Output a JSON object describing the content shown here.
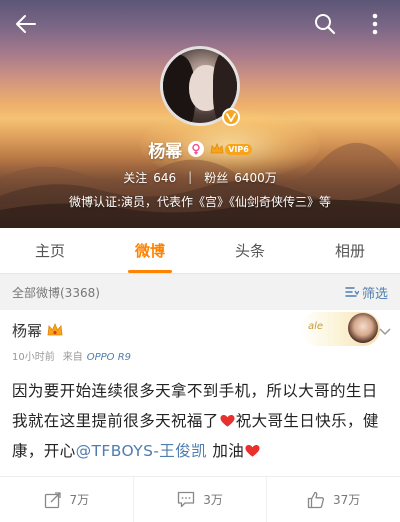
{
  "profile": {
    "name": "杨幂",
    "vip_label": "VIP6",
    "follow_label": "关注",
    "follow_count": "646",
    "fans_label": "粉丝",
    "fans_count": "6400万",
    "verification": "微博认证:演员，代表作《宫》《仙剑奇侠传三》等"
  },
  "tabs": [
    {
      "label": "主页",
      "active": false
    },
    {
      "label": "微博",
      "active": true
    },
    {
      "label": "头条",
      "active": false
    },
    {
      "label": "相册",
      "active": false
    }
  ],
  "filter_bar": {
    "count_text": "全部微博(3368)",
    "filter_label": "筛选"
  },
  "post": {
    "author": "杨幂",
    "time": "10小时前",
    "via": "来自",
    "device": "OPPO R9",
    "deco_text": "ale",
    "text_1": "因为要开始连续很多天拿不到手机，所以大哥的生日我就在这里提前很多天祝福了",
    "text_2": "祝大哥生日快乐，健康，开心",
    "mention": "@TFBOYS-王俊凯",
    "text_3": " 加油",
    "repost_count": "7万",
    "comment_count": "3万",
    "like_count": "37万"
  },
  "colors": {
    "accent": "#ff8200",
    "link": "#507daf",
    "vip": "#f7a41b",
    "heart": "#e8312d"
  }
}
